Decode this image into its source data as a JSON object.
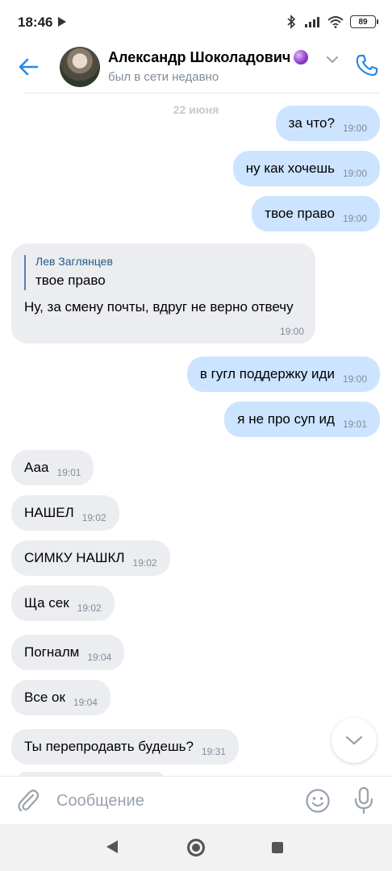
{
  "status_bar": {
    "time": "18:46",
    "battery": "89",
    "icons": [
      "play-icon",
      "bluetooth-icon",
      "signal-icon",
      "wifi-icon",
      "battery-icon"
    ]
  },
  "header": {
    "name": "Александр Шоколадович",
    "status": "был в сети недавно",
    "icons": [
      "back-arrow-icon",
      "crystal-ball-emoji",
      "chevron-down-icon",
      "phone-icon"
    ]
  },
  "chat": {
    "date": "22 июня",
    "reply_message": {
      "author": "Лев Заглянцев",
      "quoted": "твое право",
      "text": "Ну, за смену почты, вдруг не верно отвечу",
      "time": "19:00"
    },
    "messages": [
      {
        "dir": "out",
        "text": "за что?",
        "time": "19:00"
      },
      {
        "dir": "out",
        "text": "ну как хочешь",
        "time": "19:00"
      },
      {
        "dir": "out",
        "text": "твое право",
        "time": "19:00"
      },
      {
        "dir": "out",
        "text": "в гугл поддержку иди",
        "time": "19:00"
      },
      {
        "dir": "out",
        "text": "я не про суп ид",
        "time": "19:01"
      },
      {
        "dir": "in",
        "text": "Ааа",
        "time": "19:01"
      },
      {
        "dir": "in",
        "text": "НАШЕЛ",
        "time": "19:02"
      },
      {
        "dir": "in",
        "text": "СИМКУ НАШКЛ",
        "time": "19:02"
      },
      {
        "dir": "in",
        "text": "Ща сек",
        "time": "19:02"
      },
      {
        "dir": "in",
        "text": "Погналм",
        "time": "19:04"
      },
      {
        "dir": "in",
        "text": "Все ок",
        "time": "19:04"
      },
      {
        "dir": "in",
        "text": "Ты перепродавть будешь?",
        "time": "19:31"
      }
    ]
  },
  "composer": {
    "placeholder": "Сообщение",
    "icons": [
      "paperclip-icon",
      "smile-icon",
      "microphone-icon"
    ]
  },
  "colors": {
    "accent": "#5181b8",
    "outgoing_bubble": "#cce4ff",
    "incoming_bubble": "#ebedf0",
    "secondary_text": "#818c99"
  }
}
